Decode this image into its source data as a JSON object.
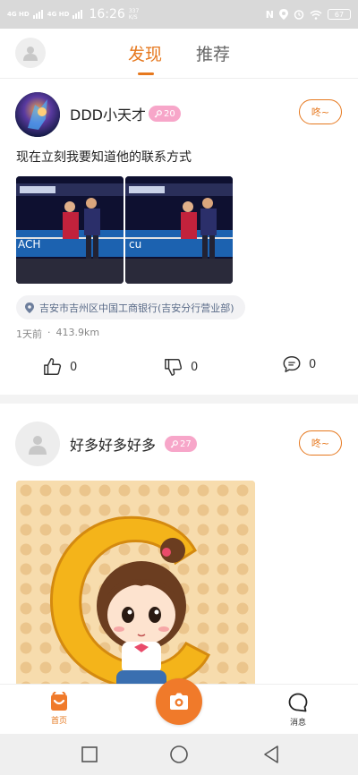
{
  "status_bar": {
    "sig1": "4G HD",
    "sig2": "4G HD",
    "time": "16:26",
    "speed": "337 K/S",
    "battery": "67"
  },
  "header": {
    "tabs": [
      {
        "label": "发现",
        "active": true
      },
      {
        "label": "推荐",
        "active": false
      }
    ]
  },
  "posts": [
    {
      "username": "DDD小天才",
      "level": "20",
      "greet_label": "咚~",
      "text": "现在立刻我要知道他的联系方式",
      "location": "吉安市吉州区中国工商银行(吉安分行营业部)",
      "time_ago": "1天前",
      "separator": "·",
      "distance": "413.9km",
      "likes": "0",
      "dislikes": "0",
      "comments": "0"
    },
    {
      "username": "好多好多好多",
      "level": "27",
      "greet_label": "咚~"
    }
  ],
  "tabbar": {
    "home_label": "首页",
    "messages_label": "消息"
  },
  "colors": {
    "accent": "#e6781e",
    "badge": "#f7a6c9",
    "location_text": "#5a6b88"
  }
}
